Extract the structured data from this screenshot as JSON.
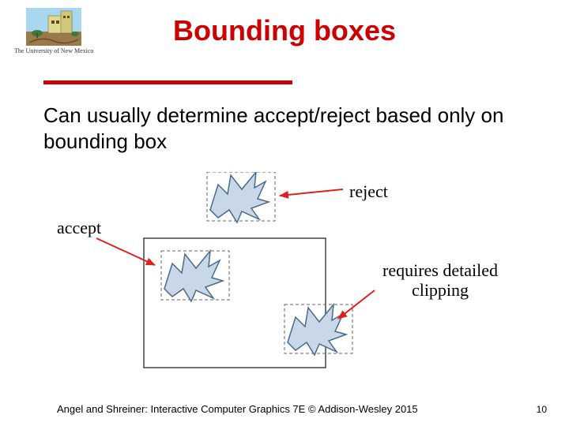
{
  "logo": {
    "caption": "The University of New Mexico"
  },
  "title": "Bounding boxes",
  "body": "Can usually determine accept/reject based only on bounding box",
  "labels": {
    "reject": "reject",
    "accept": "accept",
    "detailed_line1": "requires detailed",
    "detailed_line2": "clipping"
  },
  "footer": "Angel and Shreiner: Interactive Computer Graphics 7E © Addison-Wesley 2015",
  "page_number": "10",
  "colors": {
    "title_red": "#cc0000",
    "arrow_red": "#e02020",
    "shape_fill": "#c8d8e8",
    "shape_stroke": "#4a6a8a",
    "ground": "#8a6a3a",
    "building": "#d8d080",
    "sky": "#80c0e0"
  }
}
